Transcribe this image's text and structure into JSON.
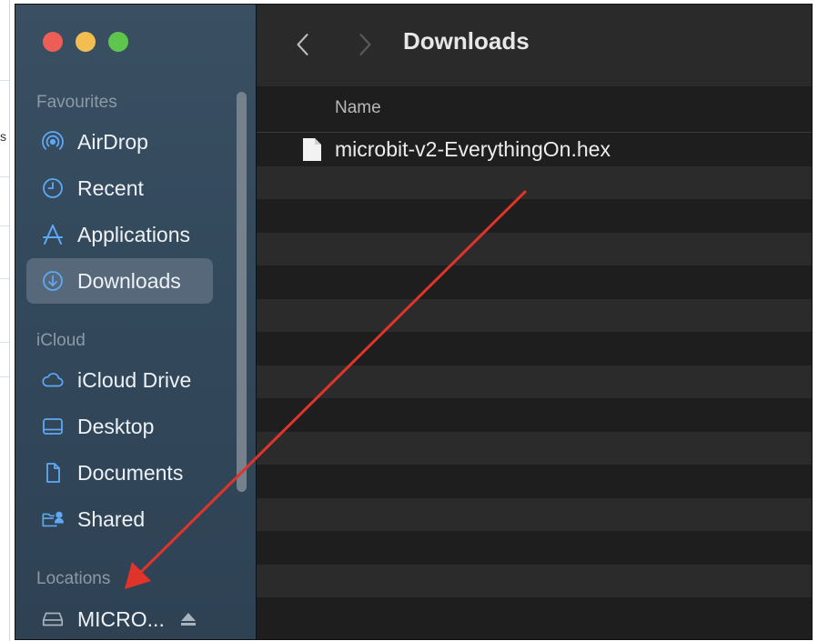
{
  "window": {
    "title": "Downloads"
  },
  "sidebar": {
    "sections": [
      {
        "label": "Favourites",
        "items": [
          {
            "label": "AirDrop",
            "icon": "airdrop-icon"
          },
          {
            "label": "Recent",
            "icon": "clock-icon"
          },
          {
            "label": "Applications",
            "icon": "applications-icon"
          },
          {
            "label": "Downloads",
            "icon": "downloads-icon",
            "selected": true
          }
        ]
      },
      {
        "label": "iCloud",
        "items": [
          {
            "label": "iCloud Drive",
            "icon": "cloud-icon"
          },
          {
            "label": "Desktop",
            "icon": "desktop-icon"
          },
          {
            "label": "Documents",
            "icon": "document-icon"
          },
          {
            "label": "Shared",
            "icon": "shared-folder-icon"
          }
        ]
      },
      {
        "label": "Locations",
        "items": [
          {
            "label": "MICRO...",
            "icon": "drive-icon",
            "eject": "eject-icon"
          }
        ]
      }
    ]
  },
  "list": {
    "column_name": "Name",
    "files": [
      {
        "name": "microbit-v2-EverythingOn.hex",
        "icon": "file-icon"
      }
    ]
  },
  "annotation": {
    "arrow_color": "#e0342a"
  },
  "colors": {
    "accent": "#5fa8f5",
    "sidebar_bg": "#33495c",
    "content_bg": "#1e1e1e"
  }
}
